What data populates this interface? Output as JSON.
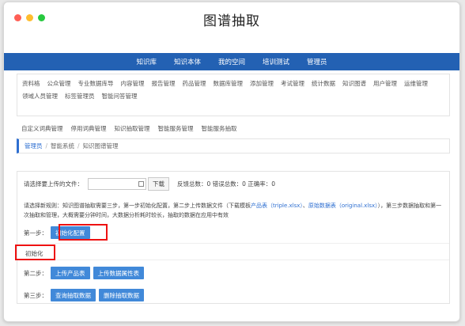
{
  "window": {
    "title": "图谱抽取"
  },
  "nav": {
    "items": [
      "知识库",
      "知识本体",
      "我的空间",
      "培训测试",
      "管理员"
    ]
  },
  "tags_row1": [
    "资料格",
    "公众管理",
    "专业数据库导",
    "内容管理",
    "报告管理",
    "药品管理",
    "数据库管理",
    "添加管理",
    "考试管理",
    "统计数据",
    "知识图谱",
    "用户管理",
    "运维管理",
    "领域人员管理",
    "标签管理员",
    "智能问答管理"
  ],
  "tags_row2": [
    "自定义词典管理",
    "停用词典管理",
    "知识抽取管理",
    "智能服务管理",
    "智能服务抽取"
  ],
  "breadcrumb": {
    "home": "管理员",
    "section": "智能系统",
    "current": "知识图谱管理"
  },
  "upload": {
    "label": "请选择要上传的文件：",
    "download_label": "下载",
    "stats_label": "反馈总数：0 错误总数：0 正确率：0"
  },
  "description": {
    "intro": "请选择新规则：知识图谱抽取需要三步，第一步初始化配置，第二步上传数据文件（下载模板",
    "link1": "产品表（triple.xlsx）",
    "mid": "、",
    "link2": "原始数据表（original.xlsx）",
    "rest": "），第三步数据抽取和第一次抽取和管理，大概需要分钟时间，大数据分析耗时较长，抽取的数据在应用中有效"
  },
  "step1": {
    "label": "第一步：",
    "button": "初始化配置"
  },
  "status_text": "初始化",
  "step2": {
    "label": "第二步：",
    "btn_a": "上传产品表",
    "btn_b": "上传数据属性表"
  },
  "step3": {
    "label": "第三步：",
    "btn_a": "查询抽取数据",
    "btn_b": "删除抽取数据"
  }
}
